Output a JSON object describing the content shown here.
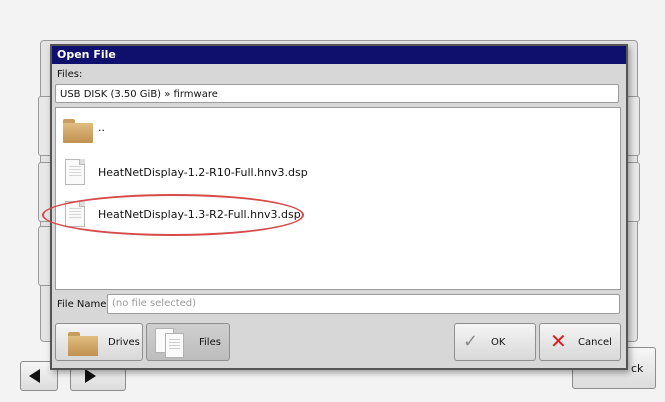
{
  "background": {
    "back_label": "ck"
  },
  "dialog": {
    "title": "Open File",
    "files_label": "Files:",
    "path": "USB DISK (3.50 GiB) » firmware",
    "files": [
      {
        "name": "..",
        "icon": "folder-icon"
      },
      {
        "name": "HeatNetDisplay-1.2-R10-Full.hnv3.dsp",
        "icon": "file-icon"
      },
      {
        "name": "HeatNetDisplay-1.3-R2-Full.hnv3.dsp",
        "icon": "file-icon",
        "highlighted": true
      }
    ],
    "file_name_label": "File Name:",
    "file_name_placeholder": "(no file selected)",
    "buttons": {
      "drives": "Drives",
      "files": "Files",
      "ok": "OK",
      "cancel": "Cancel"
    }
  },
  "colors": {
    "titlebar": "#0f0f6e",
    "highlight": "#d64a4a",
    "cancel_icon": "#d61f1f"
  }
}
